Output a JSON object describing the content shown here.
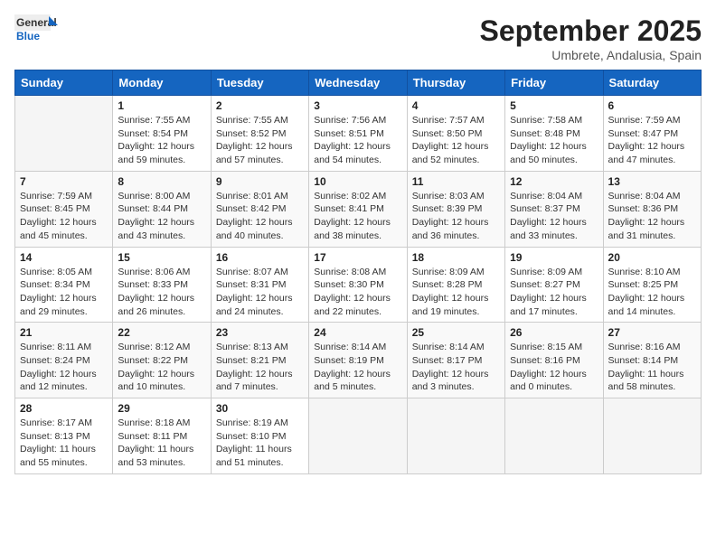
{
  "logo": {
    "general": "General",
    "blue": "Blue"
  },
  "header": {
    "month": "September 2025",
    "location": "Umbrete, Andalusia, Spain"
  },
  "days_of_week": [
    "Sunday",
    "Monday",
    "Tuesday",
    "Wednesday",
    "Thursday",
    "Friday",
    "Saturday"
  ],
  "weeks": [
    [
      {
        "day": "",
        "info": ""
      },
      {
        "day": "1",
        "info": "Sunrise: 7:55 AM\nSunset: 8:54 PM\nDaylight: 12 hours and 59 minutes."
      },
      {
        "day": "2",
        "info": "Sunrise: 7:55 AM\nSunset: 8:52 PM\nDaylight: 12 hours and 57 minutes."
      },
      {
        "day": "3",
        "info": "Sunrise: 7:56 AM\nSunset: 8:51 PM\nDaylight: 12 hours and 54 minutes."
      },
      {
        "day": "4",
        "info": "Sunrise: 7:57 AM\nSunset: 8:50 PM\nDaylight: 12 hours and 52 minutes."
      },
      {
        "day": "5",
        "info": "Sunrise: 7:58 AM\nSunset: 8:48 PM\nDaylight: 12 hours and 50 minutes."
      },
      {
        "day": "6",
        "info": "Sunrise: 7:59 AM\nSunset: 8:47 PM\nDaylight: 12 hours and 47 minutes."
      }
    ],
    [
      {
        "day": "7",
        "info": "Sunrise: 7:59 AM\nSunset: 8:45 PM\nDaylight: 12 hours and 45 minutes."
      },
      {
        "day": "8",
        "info": "Sunrise: 8:00 AM\nSunset: 8:44 PM\nDaylight: 12 hours and 43 minutes."
      },
      {
        "day": "9",
        "info": "Sunrise: 8:01 AM\nSunset: 8:42 PM\nDaylight: 12 hours and 40 minutes."
      },
      {
        "day": "10",
        "info": "Sunrise: 8:02 AM\nSunset: 8:41 PM\nDaylight: 12 hours and 38 minutes."
      },
      {
        "day": "11",
        "info": "Sunrise: 8:03 AM\nSunset: 8:39 PM\nDaylight: 12 hours and 36 minutes."
      },
      {
        "day": "12",
        "info": "Sunrise: 8:04 AM\nSunset: 8:37 PM\nDaylight: 12 hours and 33 minutes."
      },
      {
        "day": "13",
        "info": "Sunrise: 8:04 AM\nSunset: 8:36 PM\nDaylight: 12 hours and 31 minutes."
      }
    ],
    [
      {
        "day": "14",
        "info": "Sunrise: 8:05 AM\nSunset: 8:34 PM\nDaylight: 12 hours and 29 minutes."
      },
      {
        "day": "15",
        "info": "Sunrise: 8:06 AM\nSunset: 8:33 PM\nDaylight: 12 hours and 26 minutes."
      },
      {
        "day": "16",
        "info": "Sunrise: 8:07 AM\nSunset: 8:31 PM\nDaylight: 12 hours and 24 minutes."
      },
      {
        "day": "17",
        "info": "Sunrise: 8:08 AM\nSunset: 8:30 PM\nDaylight: 12 hours and 22 minutes."
      },
      {
        "day": "18",
        "info": "Sunrise: 8:09 AM\nSunset: 8:28 PM\nDaylight: 12 hours and 19 minutes."
      },
      {
        "day": "19",
        "info": "Sunrise: 8:09 AM\nSunset: 8:27 PM\nDaylight: 12 hours and 17 minutes."
      },
      {
        "day": "20",
        "info": "Sunrise: 8:10 AM\nSunset: 8:25 PM\nDaylight: 12 hours and 14 minutes."
      }
    ],
    [
      {
        "day": "21",
        "info": "Sunrise: 8:11 AM\nSunset: 8:24 PM\nDaylight: 12 hours and 12 minutes."
      },
      {
        "day": "22",
        "info": "Sunrise: 8:12 AM\nSunset: 8:22 PM\nDaylight: 12 hours and 10 minutes."
      },
      {
        "day": "23",
        "info": "Sunrise: 8:13 AM\nSunset: 8:21 PM\nDaylight: 12 hours and 7 minutes."
      },
      {
        "day": "24",
        "info": "Sunrise: 8:14 AM\nSunset: 8:19 PM\nDaylight: 12 hours and 5 minutes."
      },
      {
        "day": "25",
        "info": "Sunrise: 8:14 AM\nSunset: 8:17 PM\nDaylight: 12 hours and 3 minutes."
      },
      {
        "day": "26",
        "info": "Sunrise: 8:15 AM\nSunset: 8:16 PM\nDaylight: 12 hours and 0 minutes."
      },
      {
        "day": "27",
        "info": "Sunrise: 8:16 AM\nSunset: 8:14 PM\nDaylight: 11 hours and 58 minutes."
      }
    ],
    [
      {
        "day": "28",
        "info": "Sunrise: 8:17 AM\nSunset: 8:13 PM\nDaylight: 11 hours and 55 minutes."
      },
      {
        "day": "29",
        "info": "Sunrise: 8:18 AM\nSunset: 8:11 PM\nDaylight: 11 hours and 53 minutes."
      },
      {
        "day": "30",
        "info": "Sunrise: 8:19 AM\nSunset: 8:10 PM\nDaylight: 11 hours and 51 minutes."
      },
      {
        "day": "",
        "info": ""
      },
      {
        "day": "",
        "info": ""
      },
      {
        "day": "",
        "info": ""
      },
      {
        "day": "",
        "info": ""
      }
    ]
  ]
}
